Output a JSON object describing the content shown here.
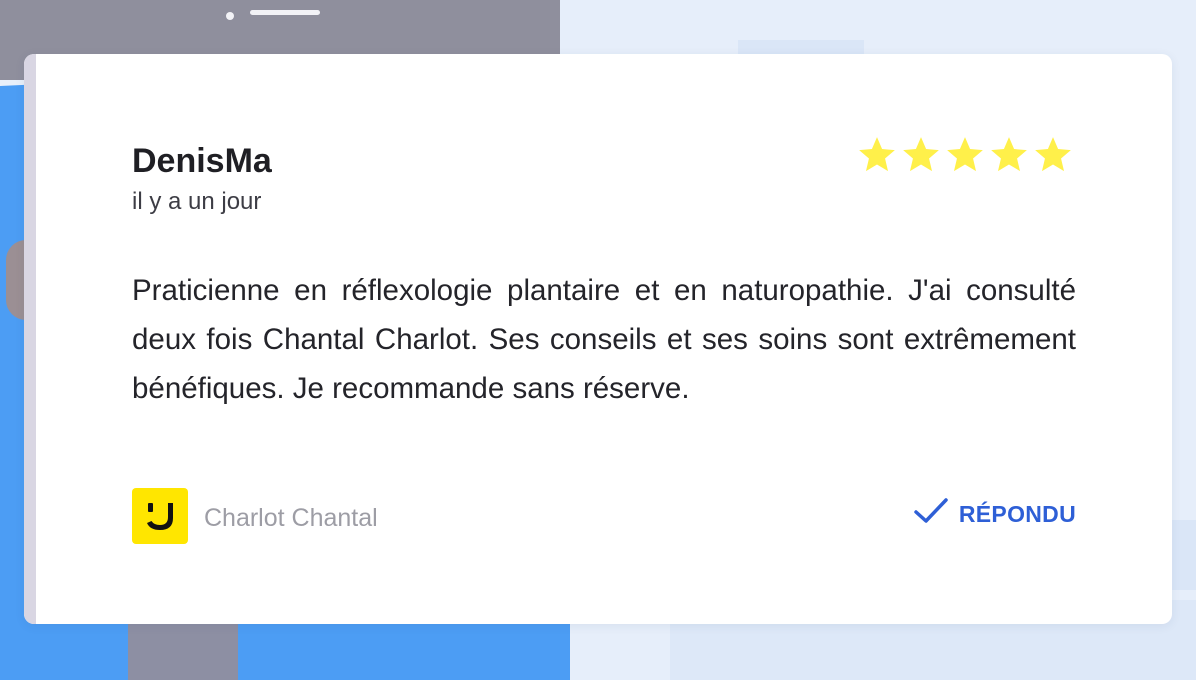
{
  "review": {
    "author": "DenisMa",
    "date": "il y a un jour",
    "rating": 5,
    "rating_max": 5,
    "text": "Praticienne en réflexologie plantaire et en naturopathie. J'ai consulté deux fois Chantal Charlot. Ses conseils et ses soins sont extrêmement bénéfiques. Je recommande sans réserve."
  },
  "merchant": {
    "name": "Charlot Chantal",
    "logo_icon": "smile-logo-icon",
    "logo_color": "#ffe600"
  },
  "reply": {
    "label": "RÉPONDU",
    "icon": "check-icon",
    "color": "#2e5fd6"
  },
  "colors": {
    "star": "#fff04a",
    "background_blue": "#4c9df4",
    "card": "#ffffff"
  }
}
